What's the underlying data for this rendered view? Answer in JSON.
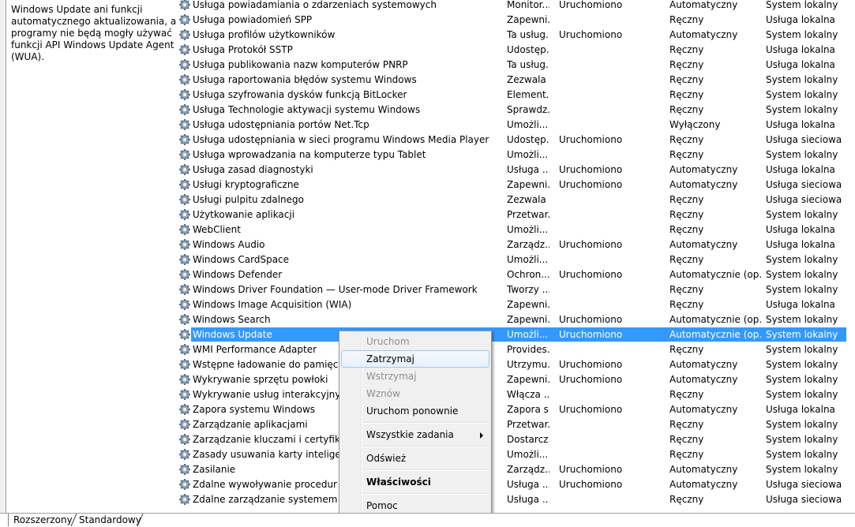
{
  "description_panel": {
    "lines": [
      "Windows Update ani funkcji",
      "automatycznego aktualizowania, a",
      "programy nie będą mogły używać",
      "funkcji API Windows Update Agent",
      "(WUA)."
    ]
  },
  "services": [
    {
      "name": "Usługa powiadamiania o zdarzeniach systemowych",
      "desc": "Monitor...",
      "status": "Uruchomiono",
      "startup": "Automatyczny",
      "logon": "System lokalny"
    },
    {
      "name": "Usługa powiadomień SPP",
      "desc": "Zapewni...",
      "status": "",
      "startup": "Ręczny",
      "logon": "Usługa lokalna"
    },
    {
      "name": "Usługa profilów użytkowników",
      "desc": "Ta usług...",
      "status": "Uruchomiono",
      "startup": "Automatyczny",
      "logon": "System lokalny"
    },
    {
      "name": "Usługa Protokół SSTP",
      "desc": "Udostęp...",
      "status": "",
      "startup": "Ręczny",
      "logon": "Usługa lokalna"
    },
    {
      "name": "Usługa publikowania nazw komputerów PNRP",
      "desc": "Ta usług...",
      "status": "",
      "startup": "Ręczny",
      "logon": "Usługa lokalna"
    },
    {
      "name": "Usługa raportowania błędów systemu Windows",
      "desc": "Zezwala ...",
      "status": "",
      "startup": "Ręczny",
      "logon": "System lokalny"
    },
    {
      "name": "Usługa szyfrowania dysków funkcją BitLocker",
      "desc": "Element...",
      "status": "",
      "startup": "Ręczny",
      "logon": "System lokalny"
    },
    {
      "name": "Usługa Technologie aktywacji systemu Windows",
      "desc": "Sprawdz...",
      "status": "",
      "startup": "Ręczny",
      "logon": "System lokalny"
    },
    {
      "name": "Usługa udostępniania portów Net.Tcp",
      "desc": "Umożli...",
      "status": "",
      "startup": "Wyłączony",
      "logon": "Usługa lokalna"
    },
    {
      "name": "Usługa udostępniania w sieci programu Windows Media Player",
      "desc": "Udostęp...",
      "status": "Uruchomiono",
      "startup": "Ręczny",
      "logon": "Usługa sieciowa"
    },
    {
      "name": "Usługa wprowadzania na komputerze typu Tablet",
      "desc": "Umożli...",
      "status": "",
      "startup": "Ręczny",
      "logon": "System lokalny"
    },
    {
      "name": "Usługa zasad diagnostyki",
      "desc": "Usługa ...",
      "status": "Uruchomiono",
      "startup": "Automatyczny",
      "logon": "Usługa lokalna"
    },
    {
      "name": "Usługi kryptograficzne",
      "desc": "Zapewni...",
      "status": "Uruchomiono",
      "startup": "Automatyczny",
      "logon": "Usługa sieciowa"
    },
    {
      "name": "Usługi pulpitu zdalnego",
      "desc": "Zezwala ...",
      "status": "",
      "startup": "Ręczny",
      "logon": "Usługa sieciowa"
    },
    {
      "name": "Użytkowanie aplikacji",
      "desc": "Przetwar...",
      "status": "",
      "startup": "Ręczny",
      "logon": "System lokalny"
    },
    {
      "name": "WebClient",
      "desc": "Umożli...",
      "status": "",
      "startup": "Ręczny",
      "logon": "Usługa lokalna"
    },
    {
      "name": "Windows Audio",
      "desc": "Zarządz...",
      "status": "Uruchomiono",
      "startup": "Automatyczny",
      "logon": "Usługa lokalna"
    },
    {
      "name": "Windows CardSpace",
      "desc": "Umożli...",
      "status": "",
      "startup": "Ręczny",
      "logon": "System lokalny"
    },
    {
      "name": "Windows Defender",
      "desc": "Ochron...",
      "status": "Uruchomiono",
      "startup": "Automatycznie (op...",
      "logon": "System lokalny"
    },
    {
      "name": "Windows Driver Foundation — User-mode Driver Framework",
      "desc": "Tworzy ...",
      "status": "",
      "startup": "Ręczny",
      "logon": "System lokalny"
    },
    {
      "name": "Windows Image Acquisition (WIA)",
      "desc": "Zapewni...",
      "status": "",
      "startup": "Ręczny",
      "logon": "Usługa lokalna"
    },
    {
      "name": "Windows Search",
      "desc": "Zapewni...",
      "status": "Uruchomiono",
      "startup": "Automatycznie (op...",
      "logon": "System lokalny"
    },
    {
      "name": "Windows Update",
      "desc": "Umożli...",
      "status": "Uruchomiono",
      "startup": "Automatycznie (op...",
      "logon": "System lokalny",
      "selected": true
    },
    {
      "name": "WMI Performance Adapter",
      "desc": "Provides...",
      "status": "",
      "startup": "Ręczny",
      "logon": "System lokalny"
    },
    {
      "name": "Wstępne ładowanie do pamięci",
      "desc": "Utrzymu...",
      "status": "Uruchomiono",
      "startup": "Automatyczny",
      "logon": "System lokalny"
    },
    {
      "name": "Wykrywanie sprzętu powłoki",
      "desc": "Zapewni...",
      "status": "Uruchomiono",
      "startup": "Automatyczny",
      "logon": "System lokalny"
    },
    {
      "name": "Wykrywanie usług interakcyjnych",
      "desc": "Włącza ...",
      "status": "",
      "startup": "Ręczny",
      "logon": "System lokalny"
    },
    {
      "name": "Zapora systemu Windows",
      "desc": "Zapora s...",
      "status": "Uruchomiono",
      "startup": "Automatyczny",
      "logon": "Usługa lokalna"
    },
    {
      "name": "Zarządzanie aplikacjami",
      "desc": "Przetwar...",
      "status": "",
      "startup": "Ręczny",
      "logon": "System lokalny"
    },
    {
      "name": "Zarządzanie kluczami i certyfikatami",
      "desc": "Dostarcz...",
      "status": "",
      "startup": "Ręczny",
      "logon": "System lokalny"
    },
    {
      "name": "Zasady usuwania karty inteligentnej",
      "desc": "Umożli...",
      "status": "",
      "startup": "Ręczny",
      "logon": "System lokalny"
    },
    {
      "name": "Zasilanie",
      "desc": "Zarządz...",
      "status": "Uruchomiono",
      "startup": "Automatyczny",
      "logon": "System lokalny"
    },
    {
      "name": "Zdalne wywoływanie procedur (RPC)",
      "desc": "Usługa ...",
      "status": "Uruchomiono",
      "startup": "Automatyczny",
      "logon": "Usługa sieciowa"
    },
    {
      "name": "Zdalne zarządzanie systemem Windows",
      "desc": "Usługa ...",
      "status": "",
      "startup": "Ręczny",
      "logon": "Usługa sieciowa"
    }
  ],
  "context_menu": {
    "start": "Uruchom",
    "stop": "Zatrzymaj",
    "pause": "Wstrzymaj",
    "resume": "Wznów",
    "restart": "Uruchom ponownie",
    "all_tasks": "Wszystkie zadania",
    "refresh": "Odśwież",
    "properties": "Właściwości",
    "help": "Pomoc"
  },
  "tabs": {
    "extended": "Rozszerzony",
    "standard": "Standardowy"
  },
  "colors": {
    "selection": "#3399ff",
    "menu_bg": "#f0f0f0",
    "disabled_text": "#8d8d8d"
  }
}
